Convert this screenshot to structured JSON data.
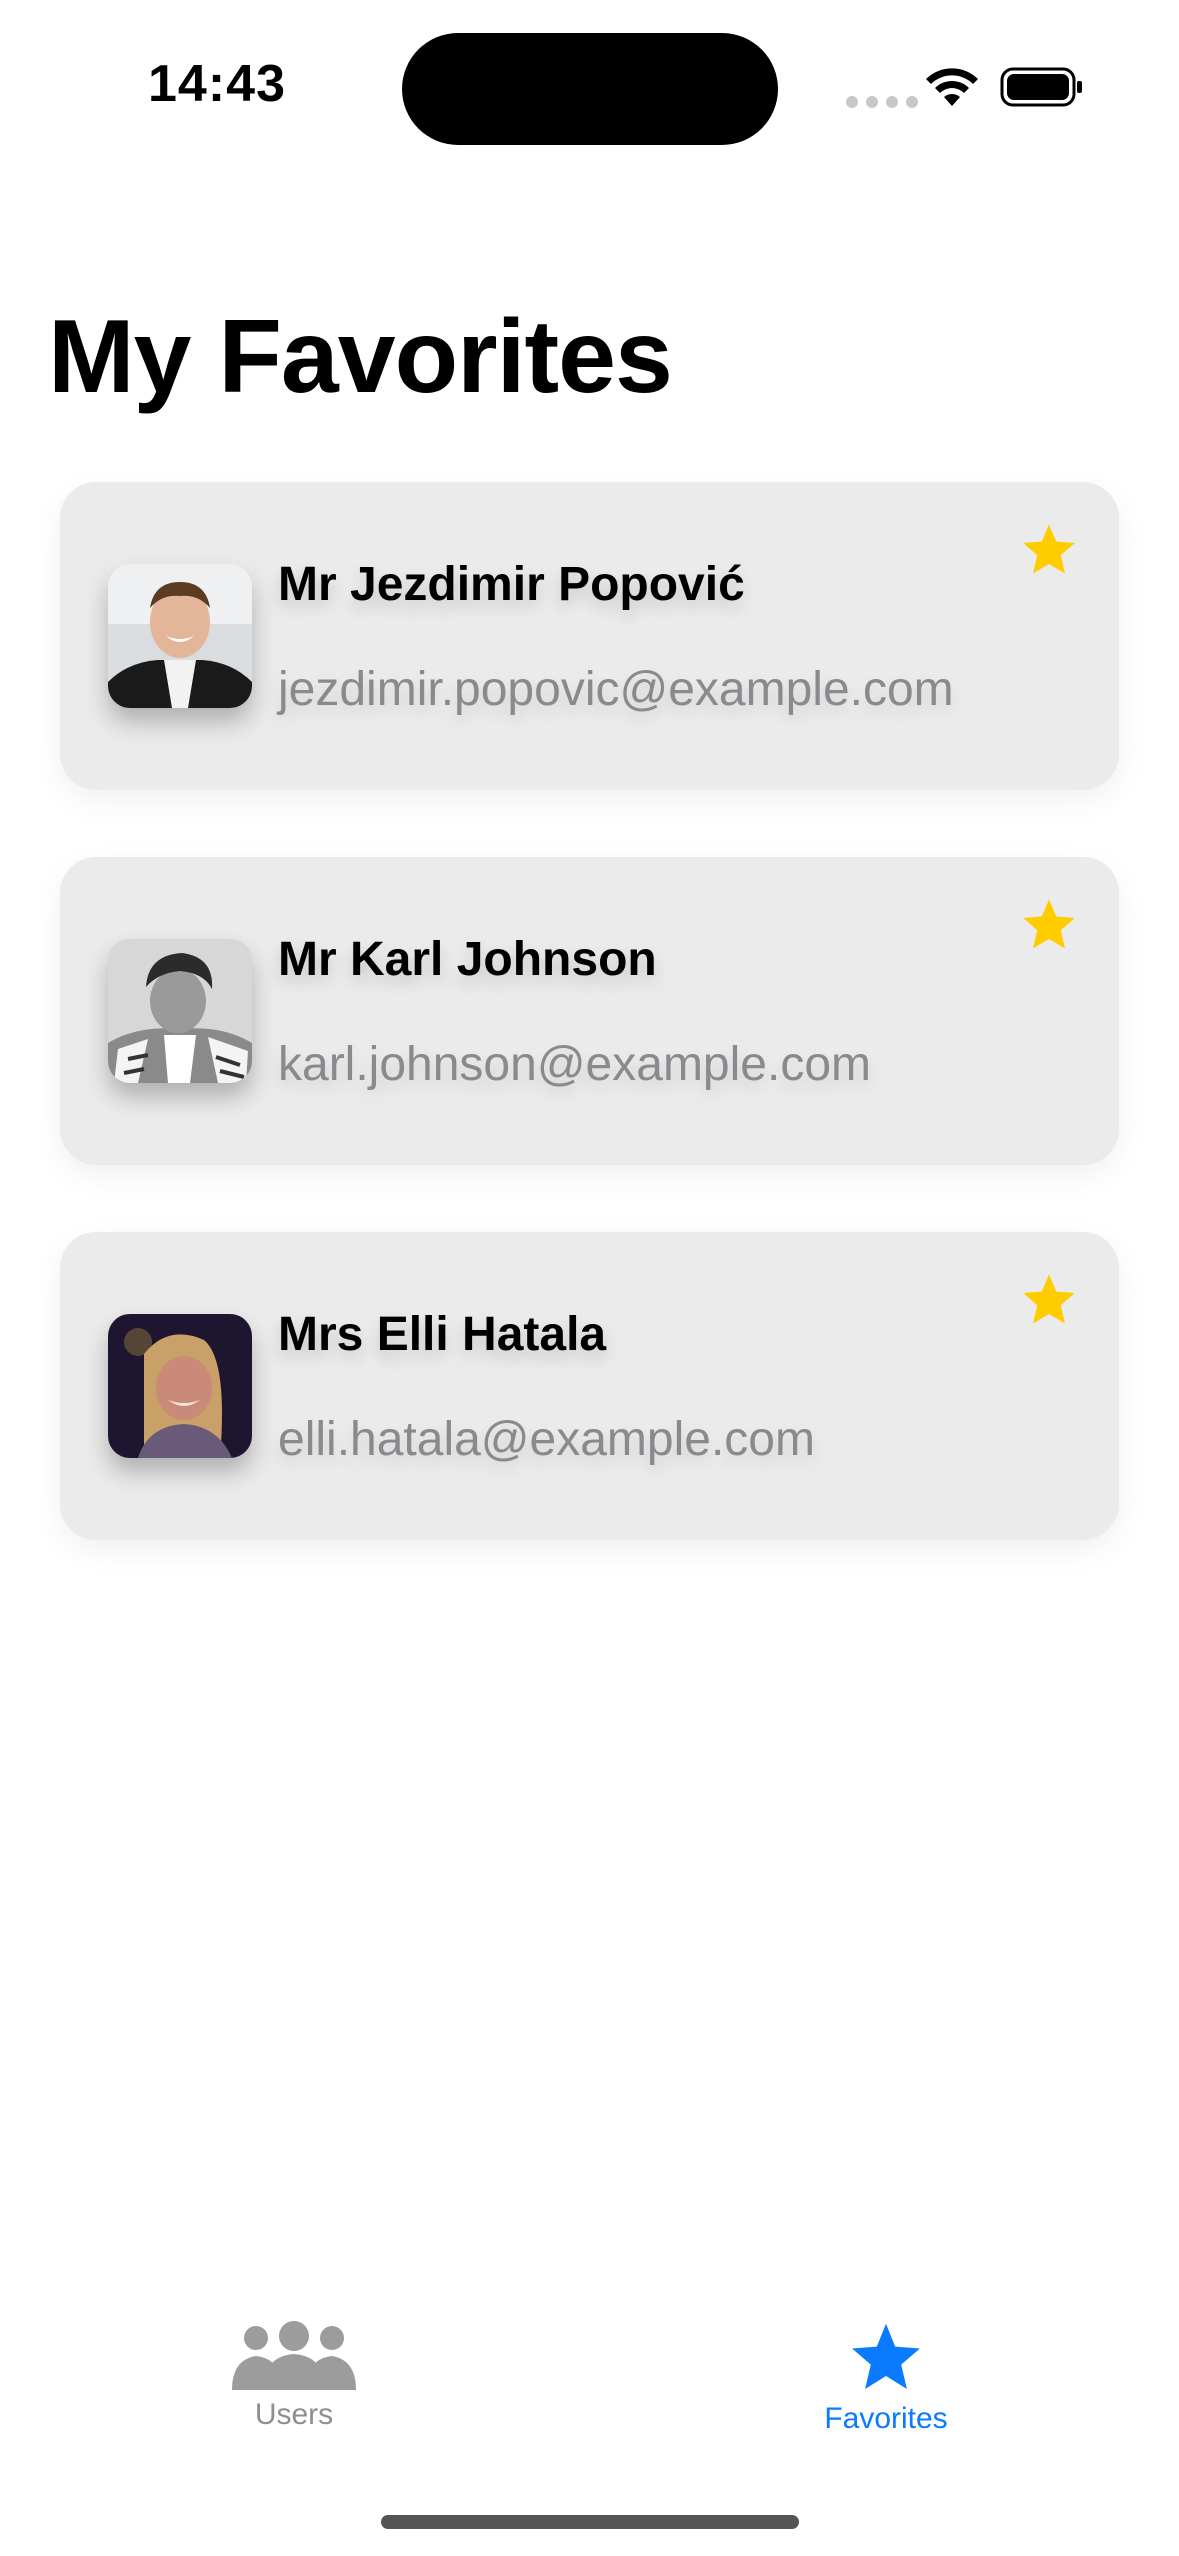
{
  "status_bar": {
    "time": "14:43"
  },
  "page": {
    "title": "My Favorites"
  },
  "favorites": [
    {
      "name": "Mr Jezdimir Popović",
      "email": "jezdimir.popovic@example.com",
      "favorited": true
    },
    {
      "name": "Mr Karl Johnson",
      "email": "karl.johnson@example.com",
      "favorited": true
    },
    {
      "name": "Mrs Elli Hatala",
      "email": "elli.hatala@example.com",
      "favorited": true
    }
  ],
  "tab_bar": {
    "tabs": [
      {
        "label": "Users",
        "icon": "users-icon",
        "selected": false
      },
      {
        "label": "Favorites",
        "icon": "star-icon",
        "selected": true
      }
    ]
  },
  "colors": {
    "accent": "#0A7AFF",
    "star": "#FFCC00",
    "card_background": "#EBEBEB",
    "secondary_text": "#8A8A8E"
  }
}
